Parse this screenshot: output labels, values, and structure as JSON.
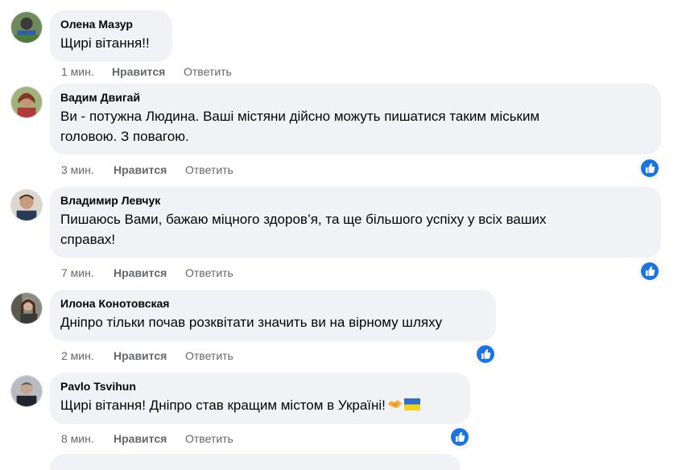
{
  "comments": [
    {
      "author": "Олена Мазур",
      "text": "Щирі вітання!!",
      "time": "1 мин.",
      "like_label": "Нравится",
      "reply_label": "Ответить",
      "reaction_icon": null
    },
    {
      "author": "Вадим Двигай",
      "text_line1": "Ви - потужна Людина. Ваші містяни дійсно можуть пишатися таким міським",
      "text_line2": "головою. З повагою.",
      "time": "3 мин.",
      "like_label": "Нравится",
      "reply_label": "Ответить",
      "reaction_icon": "thumbs-up-icon"
    },
    {
      "author": "Владимир Левчук",
      "text_line1": "Пишаюсь Вами, бажаю міцного здоров’я, та ще більшого успіху у всіх ваших",
      "text_line2": "справах!",
      "time": "7 мин.",
      "like_label": "Нравится",
      "reply_label": "Ответить",
      "reaction_icon": "thumbs-up-icon"
    },
    {
      "author": "Илона Конотовская",
      "text": "Дніпро тільки почав розквітати значить ви на вірному шляху",
      "time": "2 мин.",
      "like_label": "Нравится",
      "reply_label": "Ответить",
      "reaction_icon": "thumbs-up-icon"
    },
    {
      "author": "Pavlo Tsvihun",
      "text": "Щирі вітання! Дніпро став кращим містом в Україні!",
      "emojis": [
        "handshake-emoji",
        "ukraine-flag-emoji"
      ],
      "time": "8 мин.",
      "like_label": "Нравится",
      "reply_label": "Ответить",
      "reaction_icon": "thumbs-up-icon"
    }
  ],
  "colors": {
    "bubble_bg": "#f0f2f5",
    "text": "#050505",
    "secondary": "#65676b",
    "like_blue": "#1b74e4"
  }
}
